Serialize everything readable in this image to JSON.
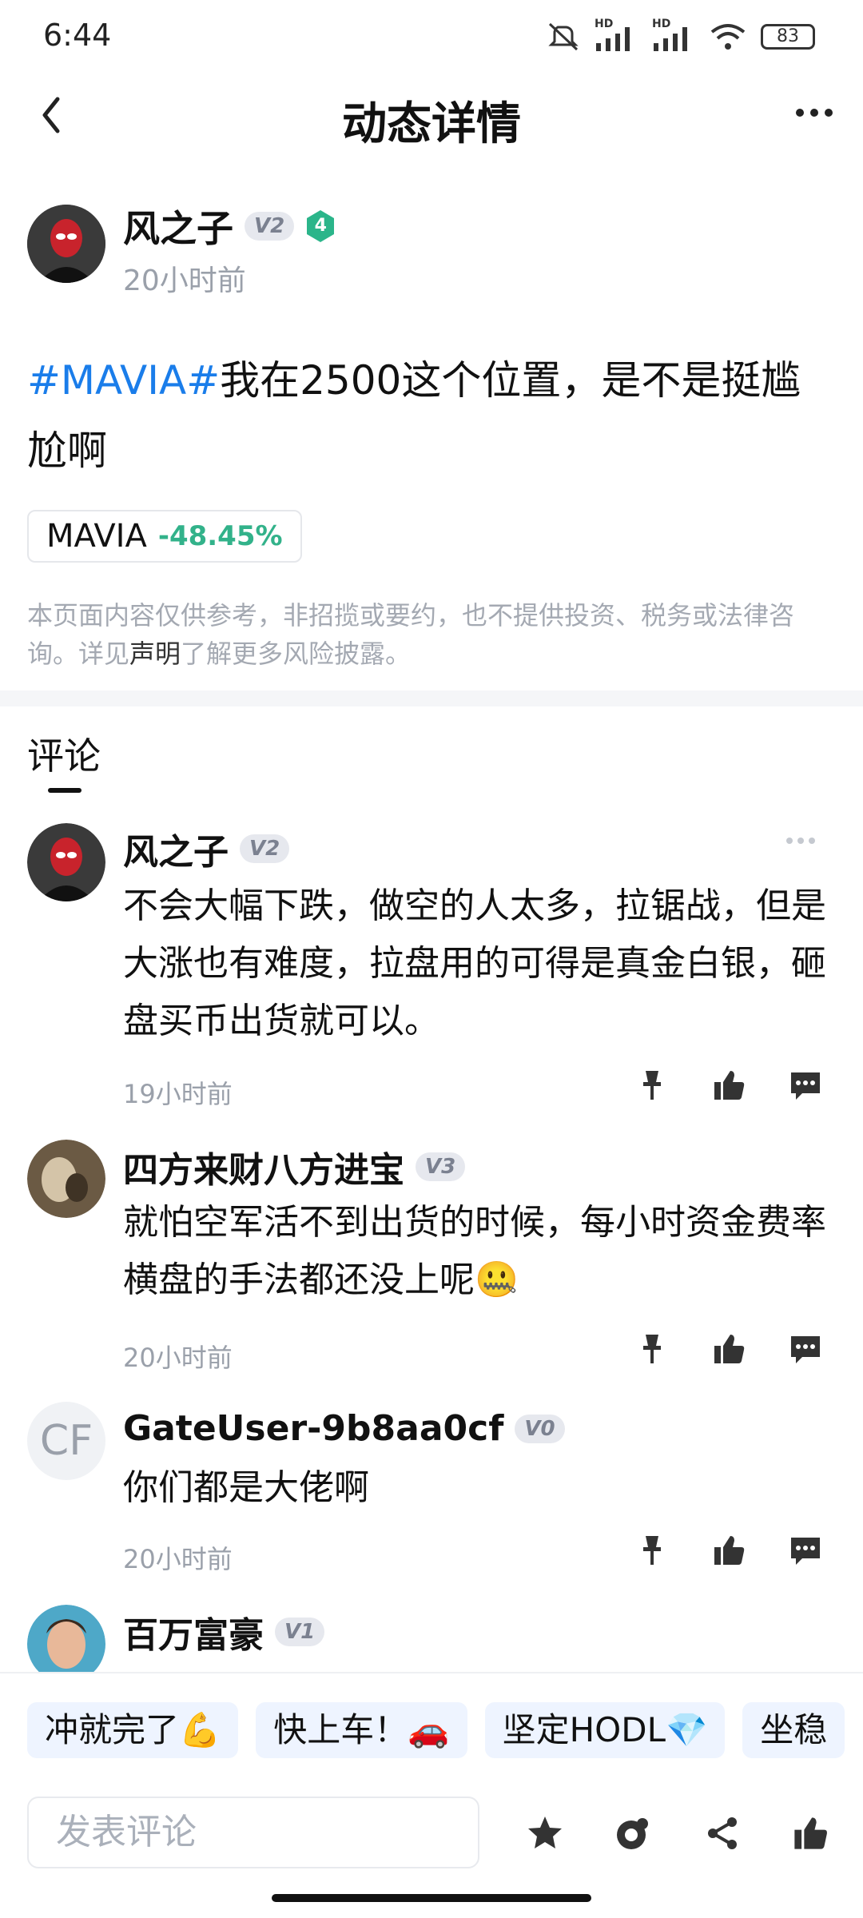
{
  "status": {
    "time": "6:44",
    "signal_1": "HD",
    "signal_2": "HD",
    "battery": "83"
  },
  "nav": {
    "title": "动态详情",
    "back_icon": "chevron-left-icon",
    "more_icon": "more-horizontal-icon"
  },
  "post": {
    "author": "风之子",
    "badge": "V2",
    "level": "4",
    "time": "20小时前",
    "hashtag": "#MAVIA#",
    "text": "我在2500这个位置，是不是挺尴尬啊",
    "token": {
      "name": "MAVIA",
      "change": "-48.45%"
    }
  },
  "disclaimer": {
    "before": "本页面内容仅供参考，非招揽或要约，也不提供投资、税务或法律咨询。详见",
    "link": "声明",
    "after": "了解更多风险披露。"
  },
  "comments_tab": "评论",
  "comments": [
    {
      "name": "风之子",
      "badge": "V2",
      "text": "不会大幅下跌，做空的人太多，拉锯战，但是大涨也有难度，拉盘用的可得是真金白银，砸盘买币出货就可以。",
      "time": "19小时前"
    },
    {
      "name": "四方来财八方进宝",
      "badge": "V3",
      "text": "就怕空军活不到出货的时候，每小时资金费率横盘的手法都还没上呢🤐",
      "time": "20小时前"
    },
    {
      "name": "GateUser-9b8aa0cf",
      "badge": "V0",
      "avatar_text": "CF",
      "text": "你们都是大佬啊",
      "time": "20小时前"
    },
    {
      "name": "百万富豪",
      "badge": "V1"
    }
  ],
  "quick_replies": [
    "冲就完了💪",
    "快上车！🚗",
    "坚定HODL💎",
    "坐稳"
  ],
  "input": {
    "placeholder": "发表评论"
  },
  "colors": {
    "hashtag": "#1a7dea",
    "change": "#32b28a",
    "muted": "#9aa0aa"
  }
}
